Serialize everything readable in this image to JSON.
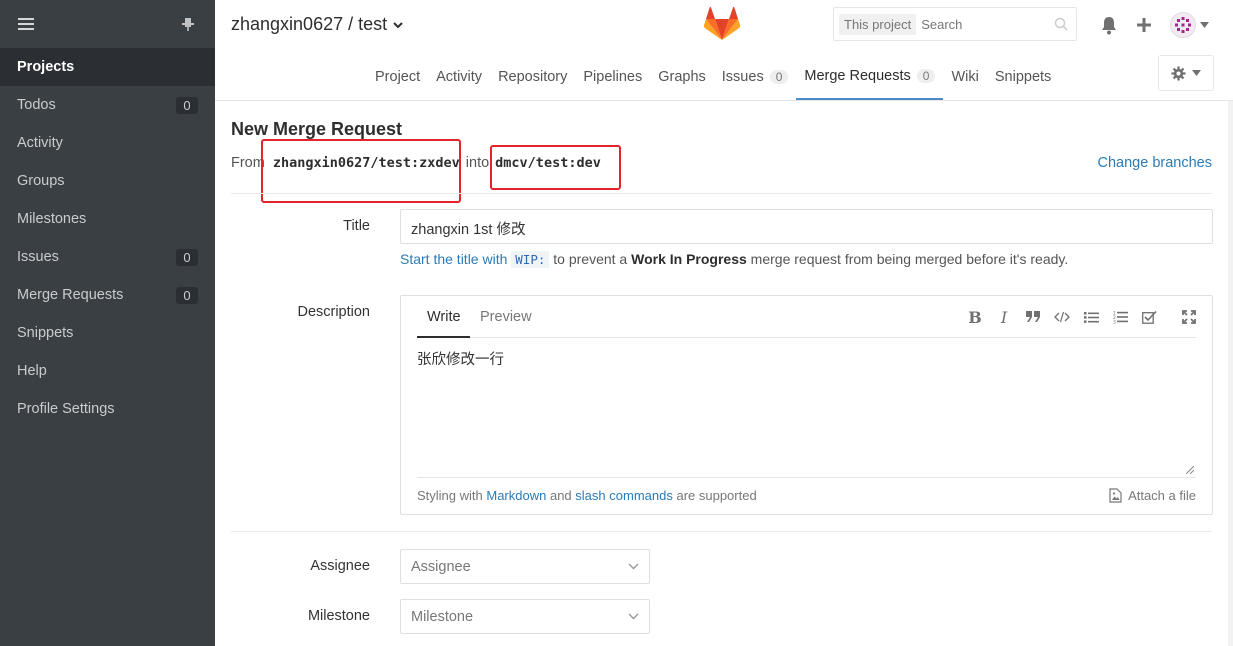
{
  "sidebar": {
    "items": [
      {
        "label": "Projects",
        "count": null
      },
      {
        "label": "Todos",
        "count": "0"
      },
      {
        "label": "Activity",
        "count": null
      },
      {
        "label": "Groups",
        "count": null
      },
      {
        "label": "Milestones",
        "count": null
      },
      {
        "label": "Issues",
        "count": "0"
      },
      {
        "label": "Merge Requests",
        "count": "0"
      },
      {
        "label": "Snippets",
        "count": null
      },
      {
        "label": "Help",
        "count": null
      },
      {
        "label": "Profile Settings",
        "count": null
      }
    ],
    "active_index": 0
  },
  "header": {
    "breadcrumb": "zhangxin0627 / test",
    "search": {
      "scope": "This project",
      "placeholder": "Search"
    },
    "nav": [
      {
        "label": "Project",
        "count": null
      },
      {
        "label": "Activity",
        "count": null
      },
      {
        "label": "Repository",
        "count": null
      },
      {
        "label": "Pipelines",
        "count": null
      },
      {
        "label": "Graphs",
        "count": null
      },
      {
        "label": "Issues",
        "count": "0"
      },
      {
        "label": "Merge Requests",
        "count": "0"
      },
      {
        "label": "Wiki",
        "count": null
      },
      {
        "label": "Snippets",
        "count": null
      }
    ],
    "nav_active": "Merge Requests"
  },
  "form": {
    "page_title": "New Merge Request",
    "from_prefix": "From",
    "source_branch": "zhangxin0627/test:zxdev",
    "into_word": "into",
    "target_branch": "dmcv/test:dev",
    "change_branches": "Change branches",
    "title_label": "Title",
    "title_value": "zhangxin 1st 修改",
    "hint": {
      "link": "Start the title with",
      "code": "WIP:",
      "mid": "to prevent a",
      "bold": "Work In Progress",
      "tail": "merge request from being merged before it's ready."
    },
    "description_label": "Description",
    "editor": {
      "tab_write": "Write",
      "tab_preview": "Preview",
      "content": "张欣修改一行",
      "footer_prefix": "Styling with",
      "footer_markdown": "Markdown",
      "footer_and": "and",
      "footer_slash": "slash commands",
      "footer_suffix": "are supported",
      "attach": "Attach a file"
    },
    "assignee_label": "Assignee",
    "assignee_placeholder": "Assignee",
    "milestone_label": "Milestone",
    "milestone_placeholder": "Milestone"
  },
  "colors": {
    "sidebar_bg": "#3a3f44",
    "link": "#2a7bb8",
    "highlight_box": "#e3242b",
    "active_tab": "#4a8bc9"
  }
}
